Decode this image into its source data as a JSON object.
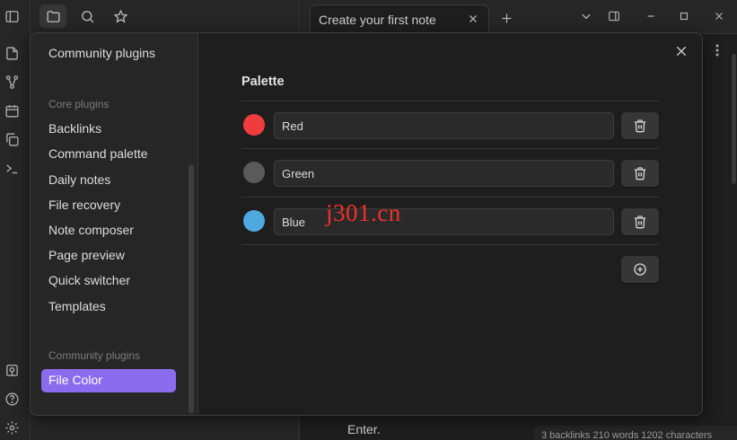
{
  "tab": {
    "title": "Create your first note"
  },
  "editor": {
    "text": "Enter.",
    "status": "3 backlinks   210 words   1202 characters"
  },
  "settings": {
    "sidebar": {
      "top_item": "Community plugins",
      "core_heading": "Core plugins",
      "core_items": [
        "Backlinks",
        "Command palette",
        "Daily notes",
        "File recovery",
        "Note composer",
        "Page preview",
        "Quick switcher",
        "Templates"
      ],
      "community_heading": "Community plugins",
      "community_items": [
        "File Color"
      ]
    },
    "palette": {
      "title": "Palette",
      "colors": [
        {
          "name": "Red",
          "color": "#f03c3c"
        },
        {
          "name": "Green",
          "color": "#5a5a5a"
        },
        {
          "name": "Blue",
          "color": "#4fa9df"
        }
      ]
    }
  },
  "watermark": "j301.cn",
  "icons": {
    "ribbon": [
      "sidebar-toggle-icon",
      "switcher-icon",
      "graph-icon",
      "calendar-icon",
      "copy-icon",
      "terminal-icon",
      "vault-icon",
      "help-icon",
      "settings-icon"
    ],
    "top": [
      "folder-icon",
      "search-icon",
      "bookmark-star-icon"
    ],
    "window": [
      "chevron-down-icon",
      "sidebar-right-icon",
      "minimize-icon",
      "maximize-icon",
      "close-icon"
    ]
  },
  "colors": {
    "accent": "#8b6cef",
    "background": "#1e1e1e",
    "sidebar": "#262626"
  }
}
